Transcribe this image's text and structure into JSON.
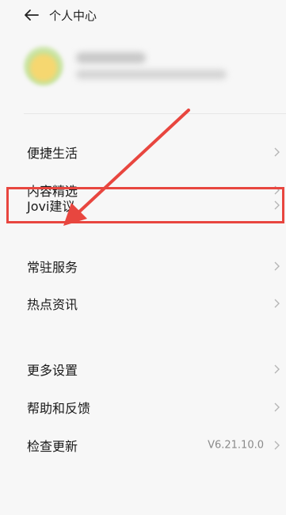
{
  "header": {
    "title": "个人中心",
    "back_icon": "arrow-left-icon"
  },
  "menu": {
    "group1": [
      {
        "label": "便捷生活"
      },
      {
        "label": "内容精选"
      },
      {
        "label": "Jovi建议"
      },
      {
        "label": "常驻服务"
      },
      {
        "label": "热点资讯"
      }
    ],
    "group2": [
      {
        "label": "更多设置"
      },
      {
        "label": "帮助和反馈"
      },
      {
        "label": "检查更新",
        "value": "V6.21.10.0"
      }
    ]
  },
  "annotation": {
    "highlight_color": "#e8463f",
    "highlighted_item": "Jovi建议"
  }
}
